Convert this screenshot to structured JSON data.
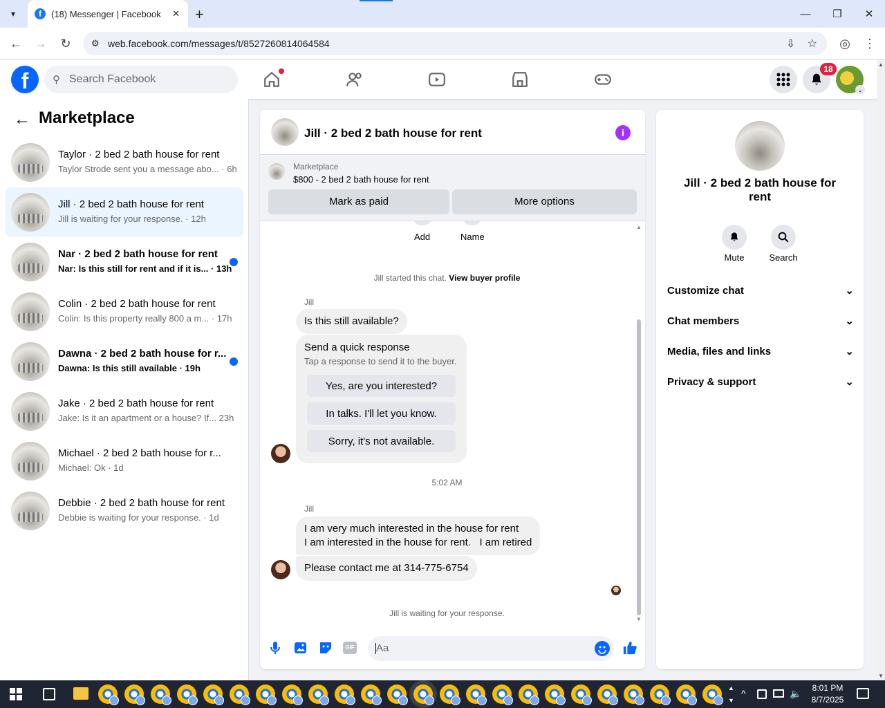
{
  "browser": {
    "tab_title": "(18) Messenger | Facebook",
    "url": "web.facebook.com/messages/t/8527260814064584",
    "new_tab": "+",
    "minimize": "—",
    "restore": "❐",
    "close": "✕"
  },
  "fb_header": {
    "logo": "f",
    "search_placeholder": "Search Facebook",
    "notifications_badge": "18"
  },
  "sidebar": {
    "title": "Marketplace",
    "conversations": [
      {
        "name": "Taylor · 2 bed 2 bath house for rent",
        "snippet": "Taylor Strode sent you a message abo... · 6h",
        "unread": false
      },
      {
        "name": "Jill · 2 bed 2 bath house for rent",
        "snippet": "Jill is waiting for your response. · 12h",
        "unread": false,
        "selected": true
      },
      {
        "name": "Nar · 2 bed 2 bath house for rent",
        "snippet": "Nar: Is this still for rent and if it is... · 13h",
        "unread": true
      },
      {
        "name": "Colin · 2 bed 2 bath house for rent",
        "snippet": "Colin: Is this property really 800 a m... · 17h",
        "unread": false
      },
      {
        "name": "Dawna · 2 bed 2 bath house for r...",
        "snippet": "Dawna: Is this still available · 19h",
        "unread": true
      },
      {
        "name": "Jake · 2 bed 2 bath house for rent",
        "snippet": "Jake: Is it an apartment or a house? If... 23h",
        "unread": false
      },
      {
        "name": "Michael · 2 bed 2 bath house for r...",
        "snippet": "Michael: Ok · 1d",
        "unread": false
      },
      {
        "name": "Debbie · 2 bed 2 bath house for rent",
        "snippet": "Debbie is waiting for your response. · 1d",
        "unread": false
      }
    ]
  },
  "chat": {
    "title": "Jill · 2 bed 2 bath house for rent",
    "listing_source": "Marketplace",
    "listing": "$800 - 2 bed 2 bath house for rent",
    "mark_paid": "Mark as paid",
    "more_options": "More options",
    "add_label": "Add",
    "name_label": "Name",
    "started_text": "Jill started this chat.",
    "view_profile": "View buyer profile",
    "sender": "Jill",
    "msg1": "Is this still available?",
    "quick_title": "Send a quick response",
    "quick_sub": "Tap a response to send it to the buyer.",
    "quick_responses": [
      "Yes, are you interested?",
      "In talks. I'll let you know.",
      "Sorry, it's not available."
    ],
    "timestamp": "5:02 AM",
    "sender2": "Jill",
    "msg2_line1": "I am very much interested in the house for rent",
    "msg2_line2": "I am interested in the house for rent.   I am retired",
    "msg3": "Please contact me at 314-775-6754",
    "waiting": "Jill is waiting for your response.",
    "composer_placeholder": "Aa",
    "gif": "GIF"
  },
  "details": {
    "title": "Jill · 2 bed 2 bath house for rent",
    "mute": "Mute",
    "search": "Search",
    "sections": [
      "Customize chat",
      "Chat members",
      "Media, files and links",
      "Privacy & support"
    ]
  },
  "taskbar": {
    "time": "8:01 PM",
    "date": "8/7/2025"
  },
  "colors": {
    "brand": "#0866ff",
    "accent_purple": "#a033ff",
    "badge": "#e41e3f"
  }
}
